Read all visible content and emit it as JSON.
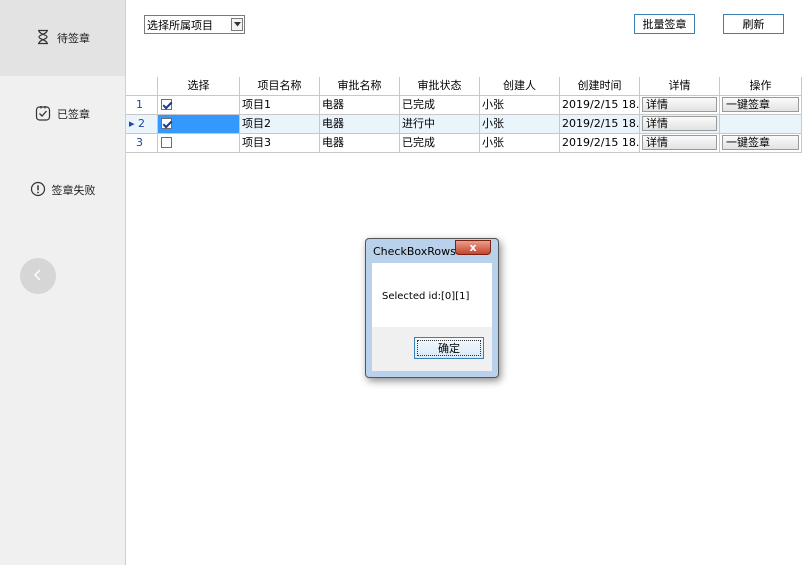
{
  "sidebar": {
    "items": [
      {
        "label": "待签章",
        "icon": "hourglass-icon"
      },
      {
        "label": "已签章",
        "icon": "check-clipboard-icon"
      },
      {
        "label": "签章失败",
        "icon": "alert-circle-icon"
      }
    ],
    "back_icon": "chevron-left-icon"
  },
  "toolbar": {
    "project_select": "选择所属项目",
    "batch_sign": "批量签章",
    "refresh": "刷新"
  },
  "grid": {
    "headers": [
      "",
      "选择",
      "项目名称",
      "审批名称",
      "审批状态",
      "创建人",
      "创建时间",
      "详情",
      "操作"
    ],
    "rows": [
      {
        "num": "1",
        "marker": "",
        "checked": true,
        "project": "项目1",
        "approval": "电器",
        "status": "已完成",
        "creator": "小张",
        "time": "2019/2/15 18...",
        "detail": "详情",
        "action": "一键签章"
      },
      {
        "num": "2",
        "marker": "▸",
        "checked": true,
        "project": "项目2",
        "approval": "电器",
        "status": "进行中",
        "creator": "小张",
        "time": "2019/2/15 18...",
        "detail": "详情",
        "action": ""
      },
      {
        "num": "3",
        "marker": "",
        "checked": false,
        "project": "项目3",
        "approval": "电器",
        "status": "已完成",
        "creator": "小张",
        "time": "2019/2/15 18...",
        "detail": "详情",
        "action": "一键签章"
      }
    ]
  },
  "dialog": {
    "title": "CheckBoxRows",
    "message": "Selected id:[0][1]",
    "ok": "确定",
    "close": "x"
  },
  "colors": {
    "accent": "#3c7fb1",
    "selection": "#3399ff"
  }
}
